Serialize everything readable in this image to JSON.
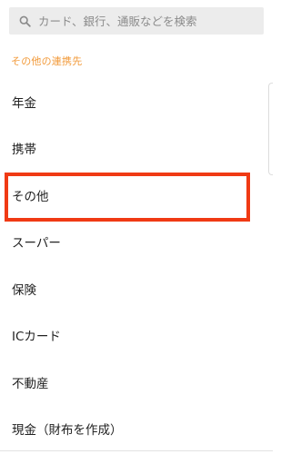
{
  "search": {
    "placeholder": "カード、銀行、通販などを検索",
    "icon": "search-icon"
  },
  "section": {
    "title": "その他の連携先"
  },
  "items": [
    {
      "label": "年金"
    },
    {
      "label": "携帯"
    },
    {
      "label": "その他",
      "highlighted": true
    },
    {
      "label": "スーパー"
    },
    {
      "label": "保険"
    },
    {
      "label": "ICカード"
    },
    {
      "label": "不動産"
    },
    {
      "label": "現金（財布を作成）"
    }
  ],
  "colors": {
    "section_header": "#f29a3a",
    "highlight_border": "#f03a14",
    "search_background": "#ececec"
  }
}
